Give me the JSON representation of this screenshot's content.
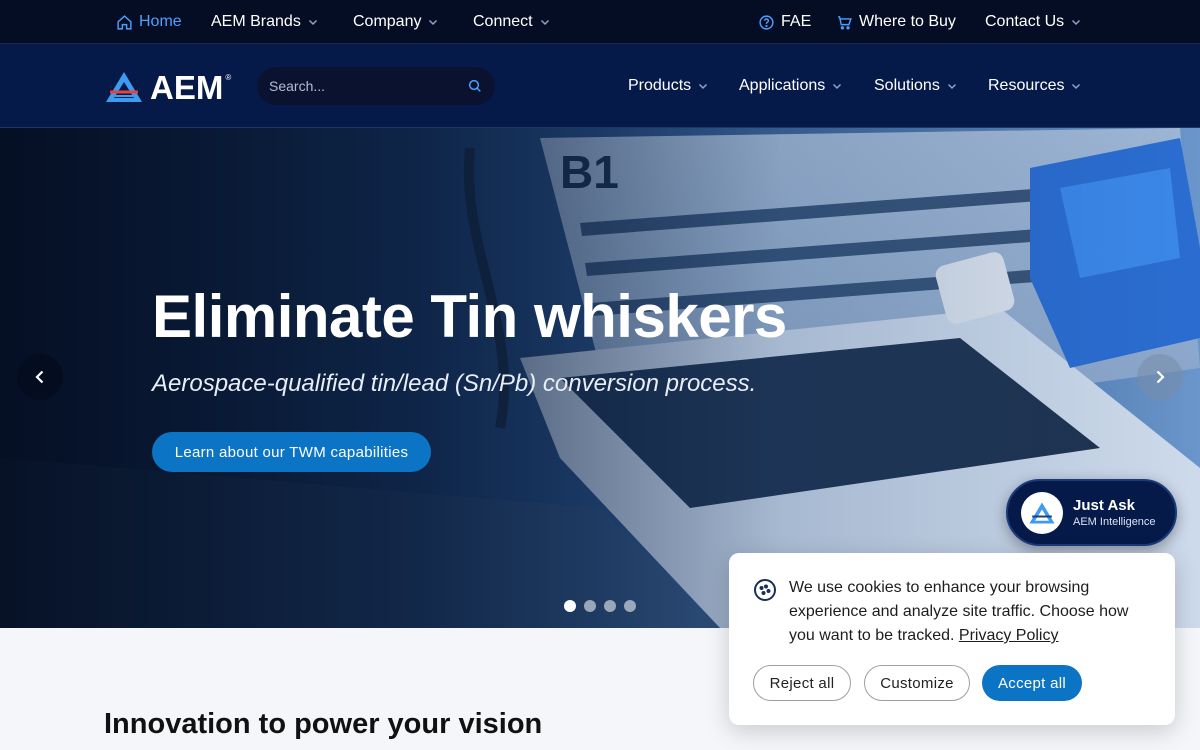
{
  "topbar": {
    "home": "Home",
    "brands": "AEM Brands",
    "company": "Company",
    "connect": "Connect",
    "fae": "FAE",
    "where_to_buy": "Where to Buy",
    "contact": "Contact Us"
  },
  "nav": {
    "logo": "AEM",
    "logo_mark": "®",
    "search_placeholder": "Search...",
    "products": "Products",
    "applications": "Applications",
    "solutions": "Solutions",
    "resources": "Resources"
  },
  "hero": {
    "title": "Eliminate Tin whiskers",
    "subtitle": "Aerospace-qualified tin/lead (Sn/Pb) conversion process.",
    "cta": "Learn about our TWM capabilities",
    "slides": 4,
    "active_slide": 1,
    "photo_label": "B1"
  },
  "section": {
    "title": "Innovation to power your vision"
  },
  "assistant": {
    "title": "Just Ask",
    "subtitle": "AEM Intelligence"
  },
  "cookie": {
    "message": "We use cookies to enhance your browsing experience and analyze site traffic. Choose how you want to be tracked.",
    "policy_link": "Privacy Policy",
    "reject": "Reject all",
    "customize": "Customize",
    "accept": "Accept all"
  },
  "colors": {
    "topbar_bg": "#050d24",
    "nav_bg": "#061a4a",
    "accent": "#0b74c5",
    "home_link": "#4ea1ff"
  }
}
